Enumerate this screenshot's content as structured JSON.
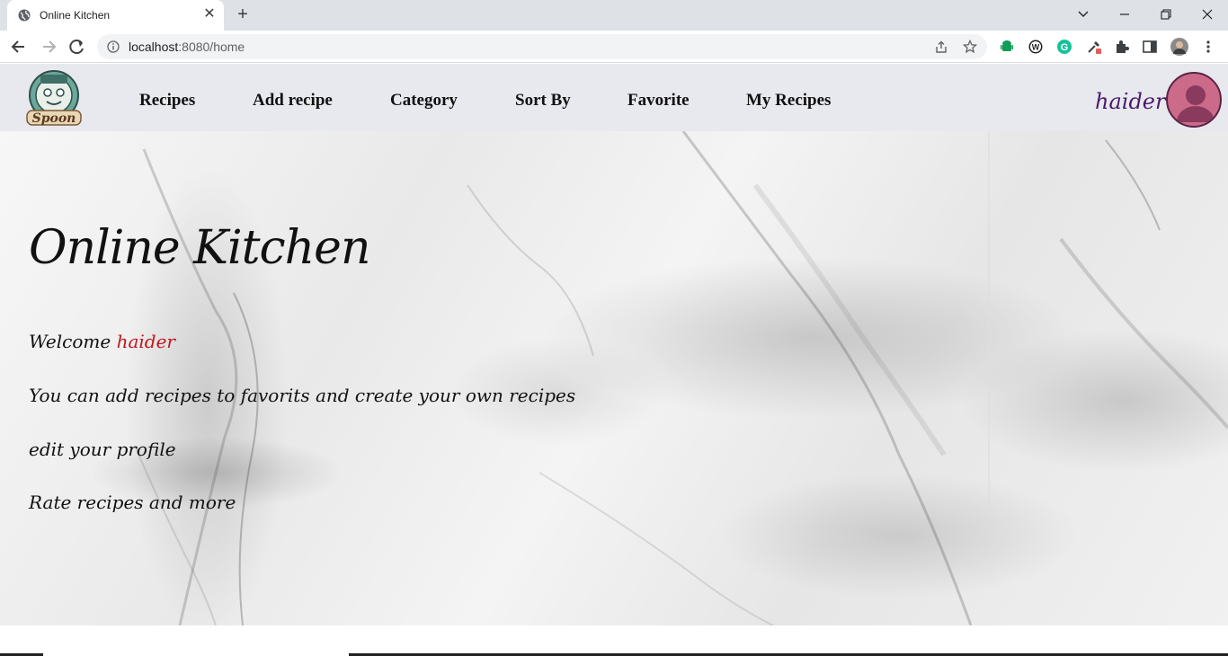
{
  "browser": {
    "tab_title": "Online Kitchen",
    "tab_close": "✕",
    "new_tab": "+",
    "url_host": "localhost",
    "url_path": ":8080/home",
    "window_controls": {
      "list": "⌄",
      "minimize": "—",
      "restore": "❐",
      "close": "✕"
    },
    "icons": [
      "back-icon",
      "forward-icon",
      "reload-icon",
      "info-icon",
      "share-icon",
      "star-icon",
      "android-icon",
      "wordpress-icon",
      "grammarly-icon",
      "eyedropper-icon",
      "extensions-icon",
      "side-panel-icon",
      "profile-avatar",
      "menu-icon"
    ]
  },
  "nav": {
    "logo_text": "Spoon",
    "links": [
      "Recipes",
      "Add recipe",
      "Category",
      "Sort By",
      "Favorite",
      "My Recipes"
    ],
    "username": "haider"
  },
  "hero": {
    "title": "Online Kitchen",
    "welcome_prefix": "Welcome",
    "welcome_name": "haider",
    "line2": "You can add recipes to favorits and create your own recipes",
    "line3": "edit your profile",
    "line4": "Rate recipes and more"
  },
  "colors": {
    "navbar_bg": "#e8e9ee",
    "username": "#4a1a6b",
    "welcome_name": "#c0161d",
    "avatar": "#cc6a8a"
  }
}
